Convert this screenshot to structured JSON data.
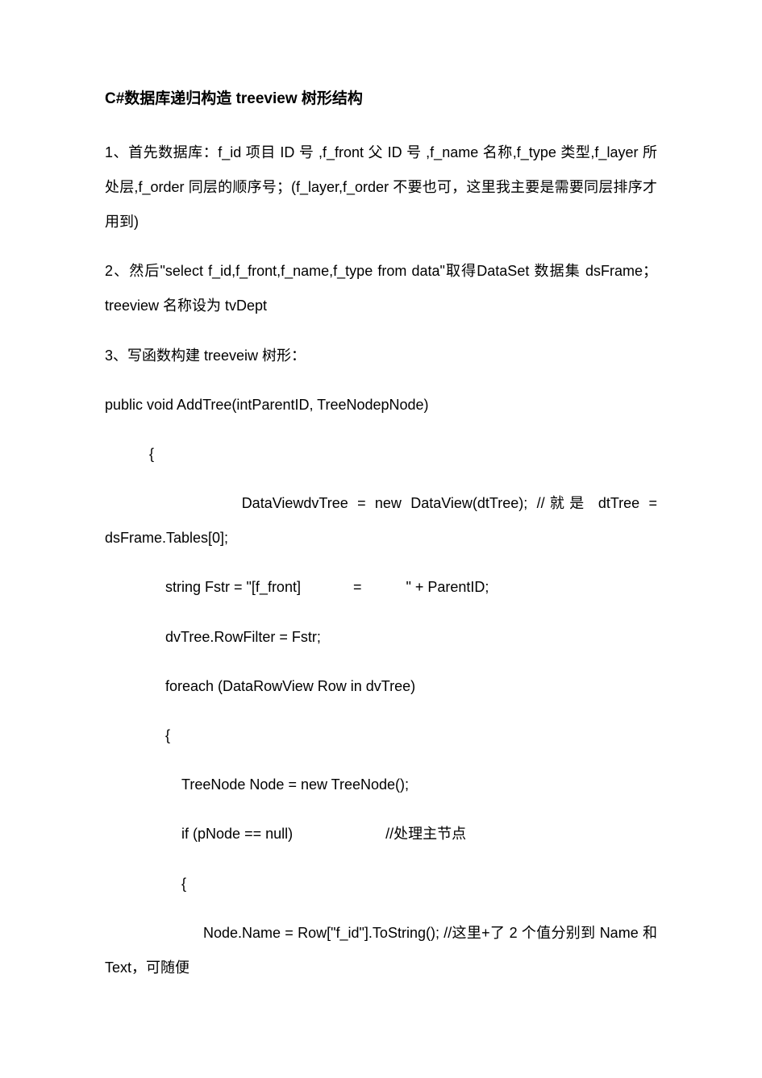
{
  "title": "C#数据库递归构造 treeview 树形结构",
  "p1": "1、首先数据库：f_id 项目 ID 号 ,f_front 父 ID 号 ,f_name 名称,f_type 类型,f_layer 所处层,f_order 同层的顺序号；(f_layer,f_order 不要也可，这里我主要是需要同层排序才用到)",
  "p2": "2、然后\"select f_id,f_front,f_name,f_type from data\"取得DataSet 数据集 dsFrame；treeview 名称设为 tvDept",
  "p3": "3、写函数构建 treeveiw 树形：",
  "c1": "public void AddTree(intParentID, TreeNodepNode)",
  "c2": "           {",
  "c3": "               DataViewdvTree = new DataView(dtTree); //就是 dtTree = dsFrame.Tables[0];",
  "c4": "               string Fstr = \"[f_front]             =           \" + ParentID;",
  "c5": "               dvTree.RowFilter = Fstr;",
  "c6": "               foreach (DataRowView Row in dvTree)",
  "c7": "               {",
  "c8": "                   TreeNode Node = new TreeNode();",
  "c9": "                   if (pNode == null)                       //处理主节点",
  "c10": "                   {",
  "c11": "                       Node.Name = Row[\"f_id\"].ToString(); //这里+了 2 个值分别到 Name 和 Text，可随便"
}
